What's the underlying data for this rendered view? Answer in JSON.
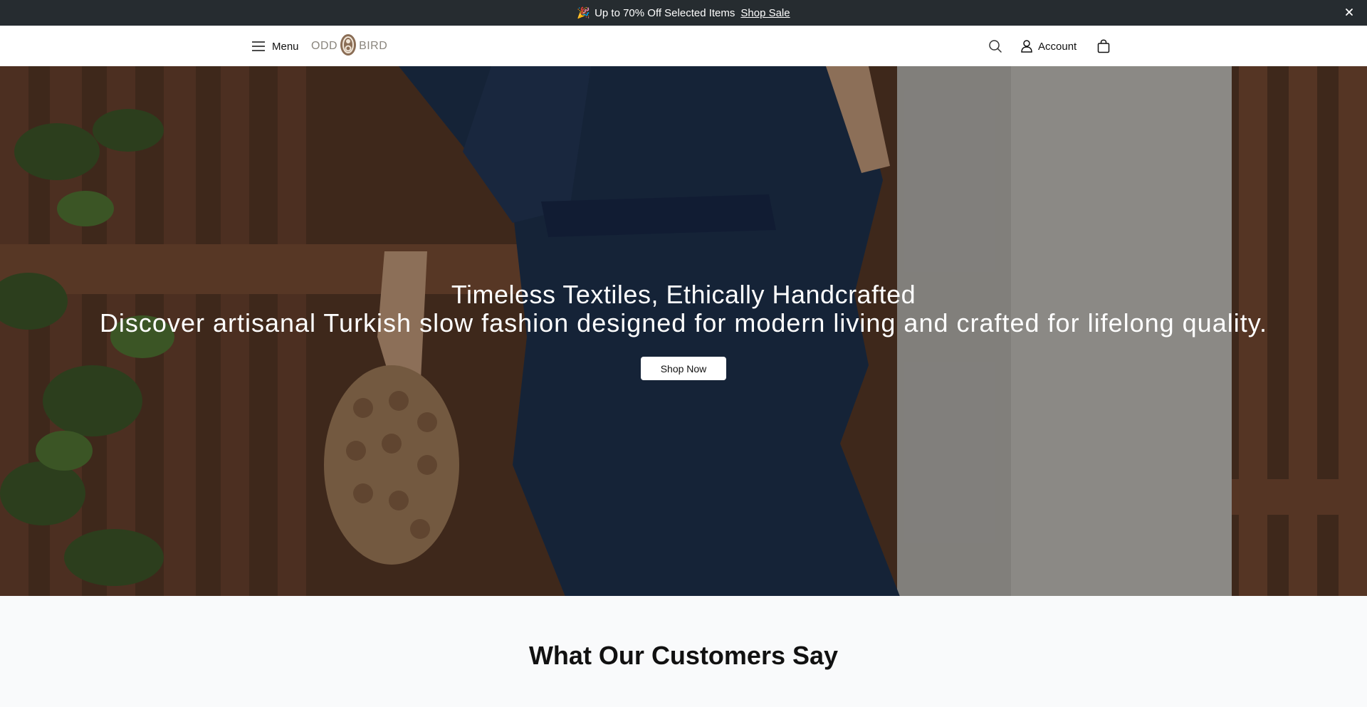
{
  "announcement": {
    "emoji": "🎉",
    "text": "Up to 70% Off Selected Items",
    "link_label": "Shop Sale",
    "close_icon": "close-icon"
  },
  "header": {
    "menu_label": "Menu",
    "logo": {
      "left": "ODD",
      "right": "BIRD"
    },
    "account_label": "Account",
    "icons": [
      "hamburger-icon",
      "search-icon",
      "user-icon",
      "shopping-bag-icon"
    ]
  },
  "hero": {
    "title": "Timeless Textiles, Ethically Handcrafted",
    "subtitle": "Discover artisanal Turkish slow fashion designed for modern living and crafted for lifelong quality.",
    "cta_label": "Shop Now"
  },
  "testimonials": {
    "title": "What Our Customers Say"
  },
  "colors": {
    "announcement_bg": "#262c30",
    "logo_color": "#8a857d",
    "page_bg": "#f9fafb"
  }
}
